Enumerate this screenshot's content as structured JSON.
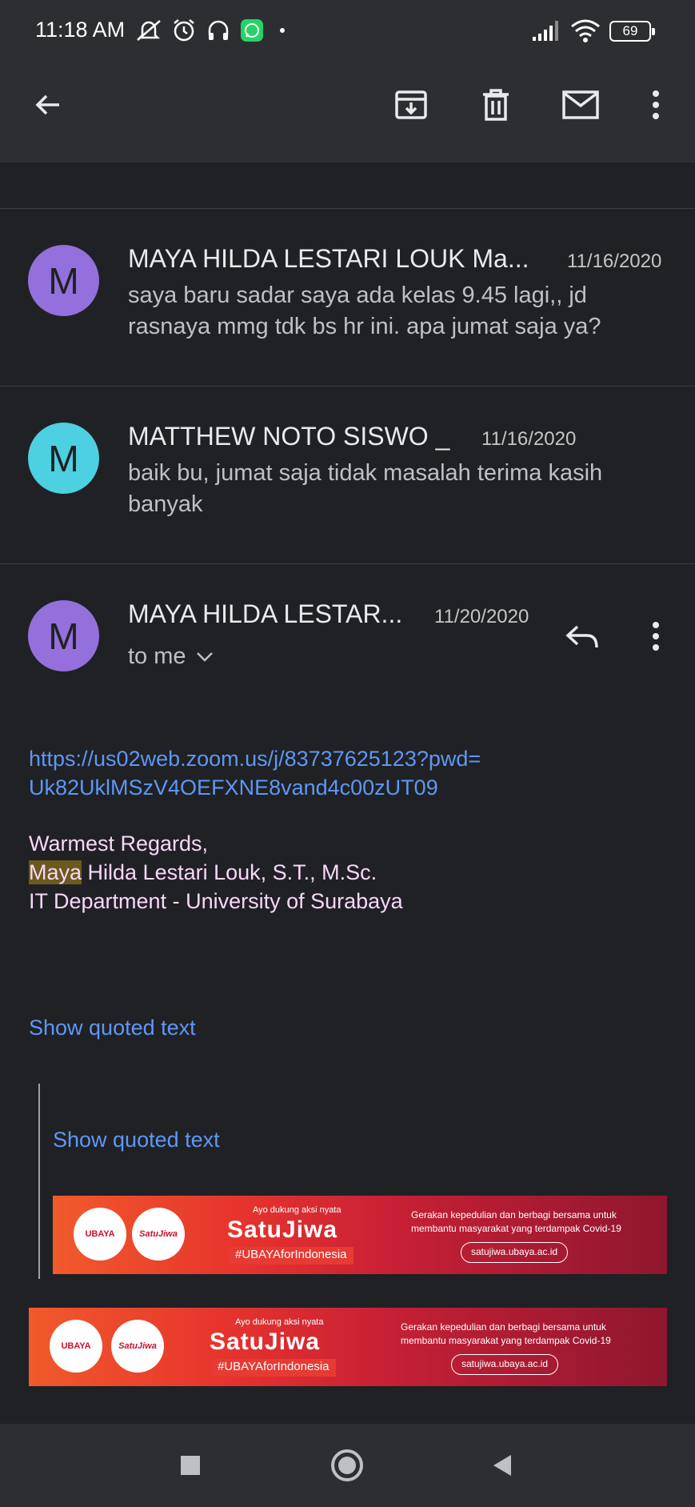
{
  "status_bar": {
    "time": "11:18 AM",
    "battery": "69",
    "icons": [
      "mute-icon",
      "alarm-icon",
      "headphones-icon",
      "whatsapp-icon",
      "dot-icon",
      "signal-icon",
      "wifi-icon",
      "battery-icon"
    ]
  },
  "app_bar": {
    "icons": [
      "back-arrow-icon",
      "archive-icon",
      "delete-icon",
      "mail-icon",
      "more-vert-icon"
    ]
  },
  "thread": {
    "messages": [
      {
        "avatar_letter": "M",
        "avatar_color": "#9370db",
        "sender": "MAYA HILDA LESTARI LOUK Ma...",
        "date": "11/16/2020",
        "snippet": "saya baru sadar saya ada kelas 9.45 lagi,, jd rasnaya mmg tdk bs hr ini. apa jumat saja ya?"
      },
      {
        "avatar_letter": "M",
        "avatar_color": "#4dd0e1",
        "sender": "MATTHEW NOTO SISWO _",
        "date": "11/16/2020",
        "snippet": "baik bu, jumat saja tidak masalah terima kasih banyak"
      }
    ],
    "expanded": {
      "avatar_letter": "M",
      "avatar_color": "#9370db",
      "sender": "MAYA HILDA LESTAR...",
      "date": "11/20/2020",
      "recipient": "to me",
      "link_line1": "https://us02web.zoom.us/j/83737625123?pwd=",
      "link_line2": "Uk82UklMSzV4OEFXNE8vand4c00zUT09",
      "greeting": "Warmest Regards,",
      "sig_name_highlight": "Maya",
      "sig_name_rest": " Hilda Lestari Louk, S.T., M.Sc.",
      "sig_dept": "IT Department - University of Surabaya",
      "show_quoted_1": "Show quoted text",
      "show_quoted_2": "Show quoted text"
    }
  },
  "banner": {
    "logo1": "UBAYA",
    "logo2": "SatuJiwa",
    "small": "Ayo dukung aksi nyata",
    "title": "SatuJiwa",
    "hashtag": "#UBAYAforIndonesia",
    "desc1": "Gerakan kepedulian dan berbagi bersama untuk",
    "desc2": "membantu masyarakat yang terdampak Covid-19",
    "url": "satujiwa.ubaya.ac.id"
  },
  "nav_bar": {
    "icons": [
      "recents-square-icon",
      "home-circle-icon",
      "back-triangle-icon"
    ]
  }
}
